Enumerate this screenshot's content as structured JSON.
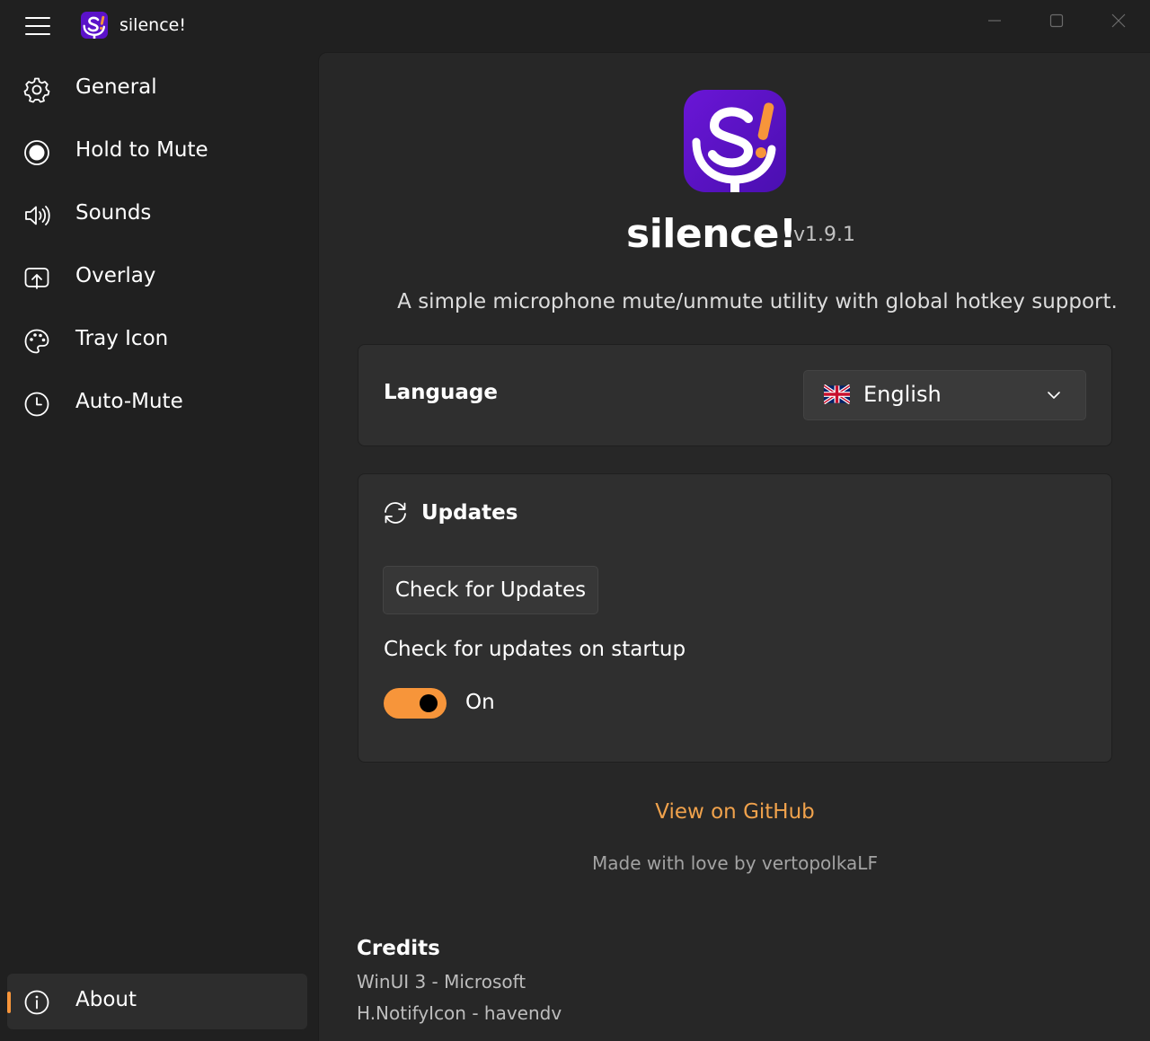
{
  "window": {
    "title": "silence!",
    "controls": [
      "minimize",
      "maximize",
      "close"
    ]
  },
  "sidebar": {
    "items": [
      {
        "label": "General",
        "icon": "gear-icon"
      },
      {
        "label": "Hold to Mute",
        "icon": "record-icon"
      },
      {
        "label": "Sounds",
        "icon": "speaker-icon"
      },
      {
        "label": "Overlay",
        "icon": "overlay-icon"
      },
      {
        "label": "Tray Icon",
        "icon": "palette-icon"
      },
      {
        "label": "Auto-Mute",
        "icon": "clock-icon"
      }
    ],
    "footer_item": {
      "label": "About",
      "icon": "info-icon",
      "selected": true
    }
  },
  "about": {
    "app_name": "silence!",
    "version": "v1.9.1",
    "tagline": "A simple microphone mute/unmute utility with global hotkey support."
  },
  "language": {
    "label": "Language",
    "selected": "English",
    "flag": "uk-flag-icon"
  },
  "updates": {
    "title": "Updates",
    "check_button": "Check for Updates",
    "startup_label": "Check for updates on startup",
    "toggle_state": "On",
    "toggle_on": true
  },
  "links": {
    "github": "View on GitHub",
    "made_by": "Made with love by vertopolkaLF"
  },
  "credits": {
    "title": "Credits",
    "items": [
      "WinUI 3 - Microsoft",
      "H.NotifyIcon - havendv"
    ]
  },
  "colors": {
    "accent": "#f7953a",
    "link": "#f0a24c",
    "logo_purple": "#5b12c9",
    "logo_orange": "#f7953a",
    "window_bg": "#202020",
    "content_bg": "#272727",
    "card_bg": "#2f2f2f"
  }
}
